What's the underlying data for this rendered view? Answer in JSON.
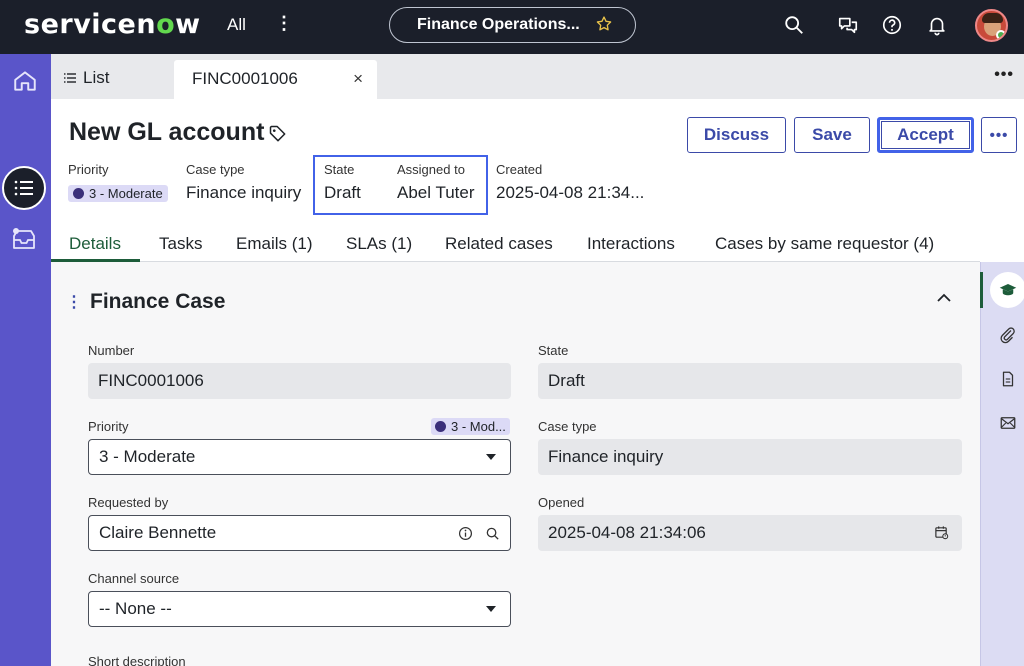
{
  "topbar": {
    "logo_text": "servicenow",
    "all_label": "All",
    "kebab": "⋮",
    "scope": "Finance Operations..."
  },
  "tabs": {
    "list_label": "List",
    "active_tab": "FINC0001006",
    "close": "×",
    "more": "•••"
  },
  "record": {
    "title": "New GL account",
    "buttons": {
      "discuss": "Discuss",
      "save": "Save",
      "accept": "Accept",
      "more": "•••"
    },
    "header_fields": {
      "priority_label": "Priority",
      "priority_value": "3 - Moderate",
      "case_type_label": "Case type",
      "case_type_value": "Finance inquiry",
      "state_label": "State",
      "state_value": "Draft",
      "assigned_label": "Assigned to",
      "assigned_value": "Abel Tuter",
      "created_label": "Created",
      "created_value": "2025-04-08 21:34..."
    }
  },
  "form_tabs": [
    "Details",
    "Tasks",
    "Emails (1)",
    "SLAs (1)",
    "Related cases",
    "Interactions",
    "Cases by same requestor (4)"
  ],
  "section": {
    "kebab": "⋮",
    "title": "Finance Case"
  },
  "fields": {
    "number_label": "Number",
    "number_value": "FINC0001006",
    "state_label": "State",
    "state_value": "Draft",
    "priority_label": "Priority",
    "priority_badge": "3 - Mod...",
    "priority_value": "3 - Moderate",
    "case_type_label": "Case type",
    "case_type_value": "Finance inquiry",
    "requested_by_label": "Requested by",
    "requested_by_value": "Claire Bennette",
    "opened_label": "Opened",
    "opened_value": "2025-04-08 21:34:06",
    "channel_label": "Channel source",
    "channel_value": "-- None --",
    "short_desc_label": "Short description"
  },
  "colors": {
    "topbar": "#1b1f2a",
    "rail": "#5a55c9",
    "accent": "#3b4aa8",
    "highlight": "#4262e8",
    "active_tab": "#1d5c3a",
    "priority_dot": "#3a2f7a"
  },
  "icons": [
    "search-icon",
    "chat-icon",
    "help-icon",
    "bell-icon",
    "star-icon",
    "home-icon",
    "list-icon",
    "inbox-icon",
    "tag-icon",
    "info-icon",
    "calendar-icon",
    "graduation-cap-icon",
    "paperclip-icon",
    "document-icon",
    "mail-icon"
  ]
}
